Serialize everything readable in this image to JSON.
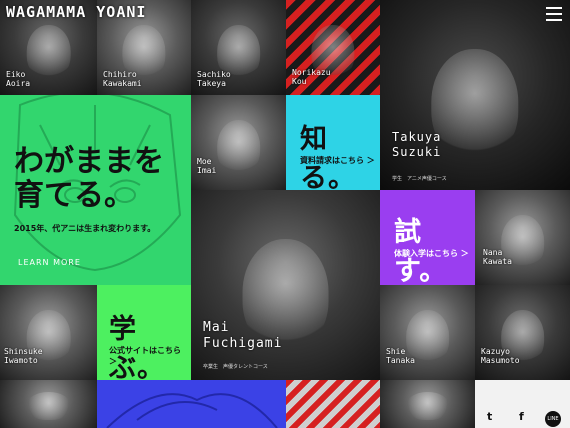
{
  "header": {
    "logo": "WAGAMAMA YOANI"
  },
  "hero": {
    "headline_line1": "わがままを",
    "headline_line2": "育てる。",
    "subtitle": "2015年、代アニは生まれ変わります。",
    "cta": "LEARN MORE"
  },
  "cards": {
    "shiru": {
      "title": "知る。",
      "link": "資料請求はこちら ＞"
    },
    "tamesu": {
      "title": "試す。",
      "link": "体験入学はこちら ＞"
    },
    "manabu": {
      "title": "学ぶ。",
      "link": "公式サイトはこちら ＞"
    }
  },
  "people": {
    "aoira": {
      "first": "Eiko",
      "last": "Aoira"
    },
    "kawakami": {
      "first": "Chihiro",
      "last": "Kawakami"
    },
    "takeya": {
      "first": "Sachiko",
      "last": "Takeya"
    },
    "kou": {
      "first": "Norikazu",
      "last": "Kou"
    },
    "imai": {
      "first": "Moe",
      "last": "Imai"
    },
    "suzuki": {
      "first": "Takuya",
      "last": "Suzuki",
      "course": "学生　アニメ声優コース"
    },
    "kawata": {
      "first": "Nana",
      "last": "Kawata"
    },
    "fuchigami": {
      "first": "Mai",
      "last": "Fuchigami",
      "course": "卒業生　声優タレントコース"
    },
    "iwamoto": {
      "first": "Shinsuke",
      "last": "Iwamoto"
    },
    "tanaka": {
      "first": "Shie",
      "last": "Tanaka"
    },
    "masumoto": {
      "first": "Kazuyo",
      "last": "Masumoto"
    }
  },
  "social": {
    "twitter": "t",
    "facebook": "f",
    "line": "LINE"
  },
  "colors": {
    "cyan": "#2ed3e6",
    "purple": "#9a3ef0",
    "green": "#4df060",
    "hero": "#32d66e",
    "red": "#d62020",
    "blue": "#3b42e6"
  }
}
